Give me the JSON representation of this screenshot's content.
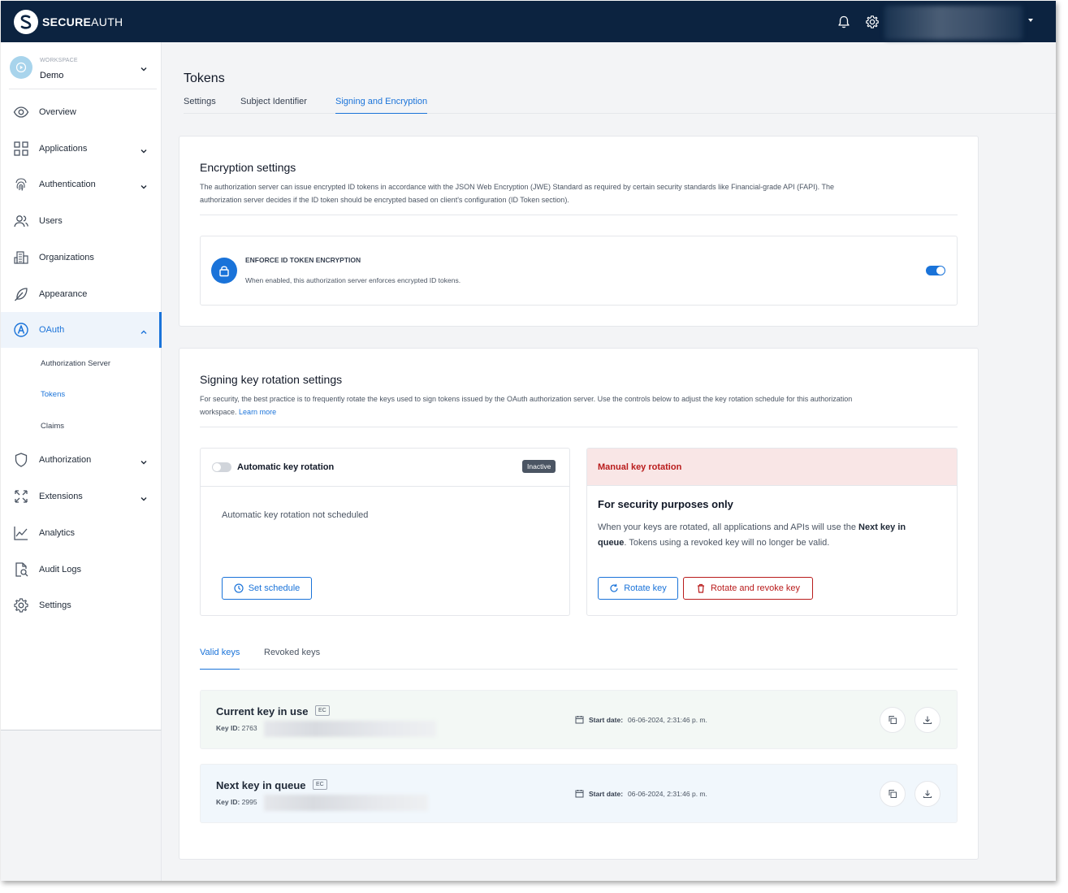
{
  "brand": {
    "bold": "SECURE",
    "light": "AUTH"
  },
  "workspace": {
    "label": "WORKSPACE",
    "name": "Demo"
  },
  "sidebar": {
    "items": [
      {
        "label": "Overview"
      },
      {
        "label": "Applications"
      },
      {
        "label": "Authentication"
      },
      {
        "label": "Users"
      },
      {
        "label": "Organizations"
      },
      {
        "label": "Appearance"
      },
      {
        "label": "OAuth"
      },
      {
        "label": "Authorization"
      },
      {
        "label": "Extensions"
      },
      {
        "label": "Analytics"
      },
      {
        "label": "Audit Logs"
      },
      {
        "label": "Settings"
      }
    ],
    "oauth_subitems": [
      {
        "label": "Authorization Server"
      },
      {
        "label": "Tokens"
      },
      {
        "label": "Claims"
      }
    ]
  },
  "page": {
    "title": "Tokens",
    "tabs": [
      {
        "label": "Settings"
      },
      {
        "label": "Subject Identifier"
      },
      {
        "label": "Signing and Encryption"
      }
    ]
  },
  "encryption": {
    "title": "Encryption settings",
    "desc_line1": "The authorization server can issue encrypted ID tokens in accordance with the JSON Web Encryption (JWE) Standard as required by certain security standards like Financial-grade API (FAPI). The",
    "desc_line2": "authorization server decides if the ID token should be encrypted based on client's configuration (ID Token section).",
    "enforce_title": "ENFORCE ID TOKEN ENCRYPTION",
    "enforce_desc": "When enabled, this authorization server enforces encrypted ID tokens.",
    "enforce_enabled": true
  },
  "signing": {
    "title": "Signing key rotation settings",
    "desc_line1": "For security, the best practice is to frequently rotate the keys used to sign tokens issued by the OAuth authorization server. Use the controls below to adjust the key rotation schedule for this authorization",
    "desc_line2": "workspace.",
    "learn_more": "Learn more",
    "automatic": {
      "title": "Automatic key rotation",
      "badge": "Inactive",
      "status": "Automatic key rotation not scheduled",
      "button": "Set schedule",
      "enabled": false
    },
    "manual": {
      "title": "Manual key rotation",
      "heading": "For security purposes only",
      "text1": "When your keys are rotated, all applications and APIs will use the ",
      "text_bold1": "Next key in",
      "text_bold2": "queue",
      "text2": ". Tokens using a revoked key will no longer be valid.",
      "rotate_button": "Rotate key",
      "revoke_button": "Rotate and revoke key"
    }
  },
  "keys": {
    "tabs": [
      {
        "label": "Valid keys"
      },
      {
        "label": "Revoked keys"
      }
    ],
    "rows": [
      {
        "title": "Current key in use",
        "type": "EC",
        "id_label": "Key ID:",
        "id_prefix": "2763",
        "date_label": "Start date:",
        "date": "06-06-2024, 2:31:46 p. m."
      },
      {
        "title": "Next key in queue",
        "type": "EC",
        "id_label": "Key ID:",
        "id_prefix": "2995",
        "date_label": "Start date:",
        "date": "06-06-2024, 2:31:46 p. m."
      }
    ]
  },
  "colors": {
    "topbar": "#0c2340",
    "accent": "#1a73d9",
    "danger": "#b91c1c",
    "manual_header_bg": "#f9e6e6",
    "current_key_bg": "#f3f8f5",
    "next_key_bg": "#f1f7fc"
  }
}
